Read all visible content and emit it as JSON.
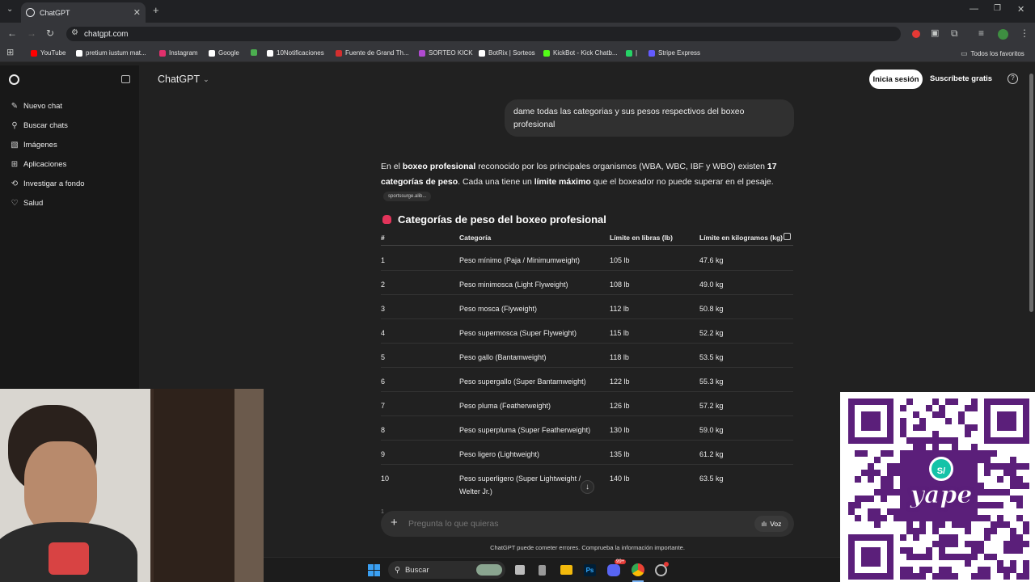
{
  "browser": {
    "tab_title": "ChatGPT",
    "url": "chatgpt.com",
    "bookmarks": [
      {
        "label": "YouTube",
        "color": "#ff0000"
      },
      {
        "label": "pretium iustum mat...",
        "color": "#ffffff"
      },
      {
        "label": "Instagram",
        "color": "#e1306c"
      },
      {
        "label": "Google",
        "color": "#ffffff"
      },
      {
        "label": "",
        "color": "#4caf50"
      },
      {
        "label": "10Notificaciones",
        "color": "#ffffff"
      },
      {
        "label": "Fuente de Grand Th...",
        "color": "#d32f2f"
      },
      {
        "label": "SORTEO KICK",
        "color": "#b04ad1"
      },
      {
        "label": "BotRix | Sorteos",
        "color": "#ffffff"
      },
      {
        "label": "KickBot - Kick Chatb...",
        "color": "#53fc18"
      },
      {
        "label": "|",
        "color": "#25d366"
      },
      {
        "label": "Stripe Express",
        "color": "#635bff"
      }
    ],
    "all_bookmarks_label": "Todos los favoritos"
  },
  "sidebar": {
    "items": [
      {
        "label": "Nuevo chat",
        "icon": "compose-icon"
      },
      {
        "label": "Buscar chats",
        "icon": "search-icon"
      },
      {
        "label": "Imágenes",
        "icon": "image-icon"
      },
      {
        "label": "Aplicaciones",
        "icon": "apps-icon"
      },
      {
        "label": "Investigar a fondo",
        "icon": "research-icon"
      },
      {
        "label": "Salud",
        "icon": "heart-icon"
      }
    ]
  },
  "header": {
    "model": "ChatGPT",
    "login": "Inicia sesión",
    "signup": "Suscríbete gratis",
    "help": "?"
  },
  "conversation": {
    "user_message": "dame todas las categorias y sus pesos respectivos del boxeo profesional",
    "intro": {
      "t1": "En el ",
      "b1": "boxeo profesional",
      "t2": " reconocido por los principales organismos (WBA, WBC, IBF y WBO) existen ",
      "b2": "17 categorías de peso",
      "t3": ". Cada una tiene un ",
      "b3": "límite máximo",
      "t4": " que el boxeador no puede superar en el pesaje."
    },
    "source": "sportssurge.alib...",
    "heading": "Categorías de peso del boxeo profesional",
    "table": {
      "headers": [
        "#",
        "Categoría",
        "Límite en libras (lb)",
        "Límite en kilogramos (kg)"
      ],
      "rows": [
        {
          "n": "1",
          "cat": "Peso mínimo (Paja / Minimumweight)",
          "lb": "105 lb",
          "kg": "47.6 kg"
        },
        {
          "n": "2",
          "cat": "Peso minimosca (Light Flyweight)",
          "lb": "108 lb",
          "kg": "49.0 kg"
        },
        {
          "n": "3",
          "cat": "Peso mosca (Flyweight)",
          "lb": "112 lb",
          "kg": "50.8 kg"
        },
        {
          "n": "4",
          "cat": "Peso supermosca (Super Flyweight)",
          "lb": "115 lb",
          "kg": "52.2 kg"
        },
        {
          "n": "5",
          "cat": "Peso gallo (Bantamweight)",
          "lb": "118 lb",
          "kg": "53.5 kg"
        },
        {
          "n": "6",
          "cat": "Peso supergallo (Super Bantamweight)",
          "lb": "122 lb",
          "kg": "55.3 kg"
        },
        {
          "n": "7",
          "cat": "Peso pluma (Featherweight)",
          "lb": "126 lb",
          "kg": "57.2 kg"
        },
        {
          "n": "8",
          "cat": "Peso superpluma (Super Featherweight)",
          "lb": "130 lb",
          "kg": "59.0 kg"
        },
        {
          "n": "9",
          "cat": "Peso ligero (Lightweight)",
          "lb": "135 lb",
          "kg": "61.2 kg"
        },
        {
          "n": "10",
          "cat": "Peso superligero (Super Lightweight / Welter Jr.)",
          "lb": "140 lb",
          "kg": "63.5 kg"
        }
      ]
    }
  },
  "composer": {
    "placeholder": "Pregunta lo que quieras",
    "voice": "Voz",
    "disclaimer": "ChatGPT puede cometer errores. Comprueba la información importante."
  },
  "taskbar": {
    "search": "Buscar",
    "badge": "99+"
  },
  "overlay": {
    "qr_brand": "yape",
    "qr_currency": "S/"
  },
  "colors": {
    "bg": "#212121",
    "sidebar": "#181818",
    "qr_purple": "#5b1f7a",
    "accent_teal": "#14c3a8"
  }
}
